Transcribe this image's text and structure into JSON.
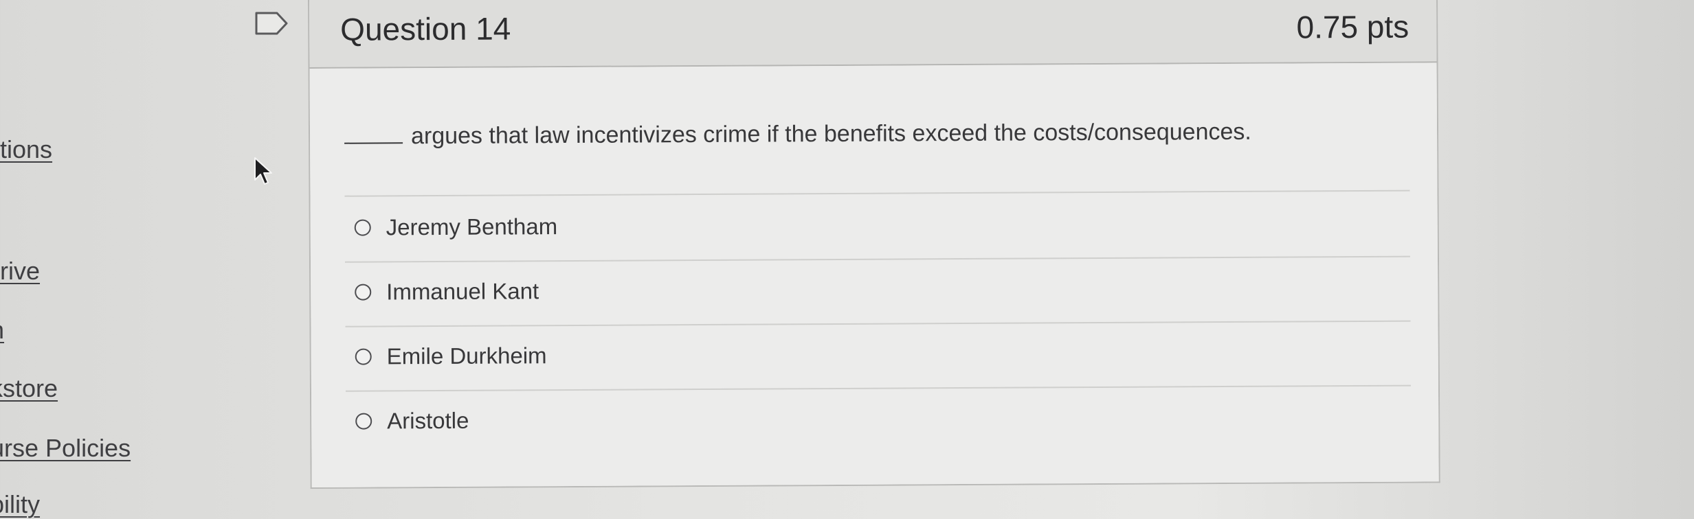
{
  "sidebar": {
    "links": [
      "tions",
      "rive",
      "n",
      "kstore",
      "urse Policies",
      "bility"
    ]
  },
  "question": {
    "title": "Question 14",
    "points": "0.75 pts",
    "text": "argues that law incentivizes crime if the benefits exceed the costs/consequences.",
    "options": [
      "Jeremy Bentham",
      "Immanuel Kant",
      "Emile Durkheim",
      "Aristotle"
    ],
    "selected_index": null
  }
}
